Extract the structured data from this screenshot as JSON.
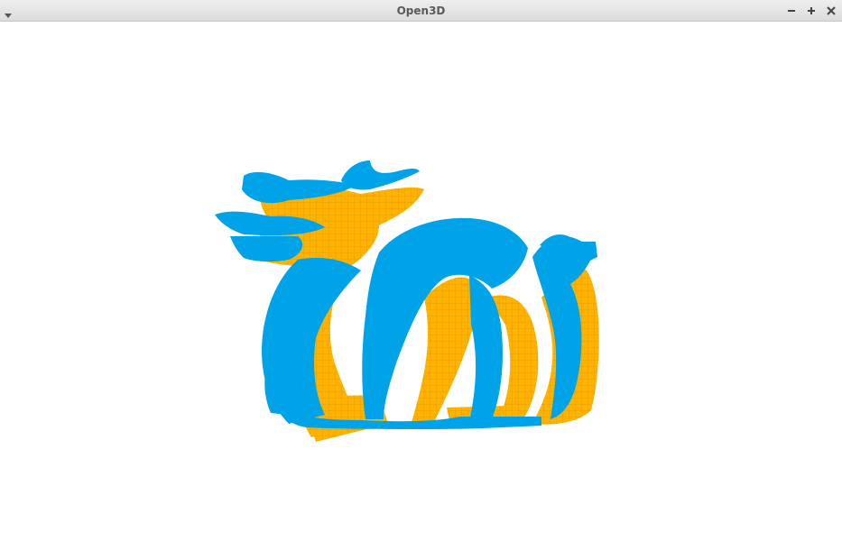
{
  "window": {
    "title": "Open3D",
    "controls": [
      "minimize-icon",
      "maximize-icon",
      "close-icon"
    ]
  },
  "viewport": {
    "background": "#ffffff",
    "point_clouds": [
      {
        "color": "#00a3e8",
        "description_icon": "dragon-point-cloud-blue"
      },
      {
        "color": "#ffb300",
        "description_icon": "dragon-point-cloud-yellow"
      }
    ]
  }
}
